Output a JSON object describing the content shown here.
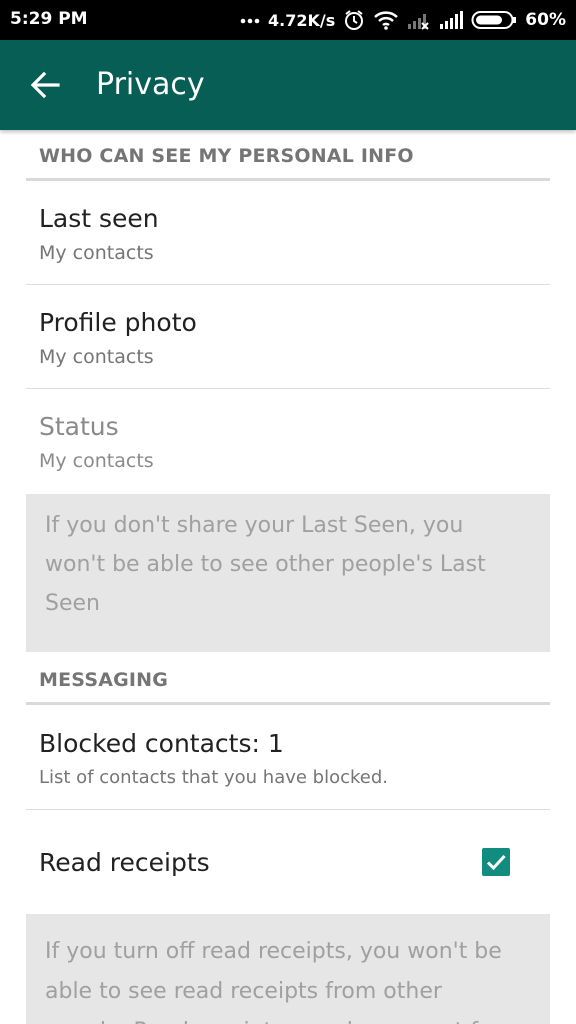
{
  "status_bar": {
    "time": "5:29 PM",
    "network_speed": "4.72K/s",
    "battery_percent": "60%",
    "icons": [
      "more-dots-icon",
      "alarm-icon",
      "wifi-icon",
      "signal-x-icon",
      "signal-icon",
      "battery-icon"
    ]
  },
  "app_bar": {
    "title": "Privacy",
    "back_icon": "arrow-left-icon",
    "color": "#075e54"
  },
  "personal_info": {
    "header": "WHO CAN SEE MY PERSONAL INFO",
    "items": [
      {
        "title": "Last seen",
        "value": "My contacts"
      },
      {
        "title": "Profile photo",
        "value": "My contacts"
      },
      {
        "title": "Status",
        "value": "My contacts"
      }
    ],
    "note": "If you don't share your Last Seen, you won't be able to see other people's Last Seen"
  },
  "messaging": {
    "header": "MESSAGING",
    "blocked": {
      "title": "Blocked contacts: 1",
      "subtitle": "List of contacts that you have blocked."
    },
    "read_receipts": {
      "title": "Read receipts",
      "checked": true,
      "check_color": "#128c7e"
    },
    "note": "If you turn off read receipts, you won't be able to see read receipts from other people. Read receipts are always sent for group chats."
  }
}
